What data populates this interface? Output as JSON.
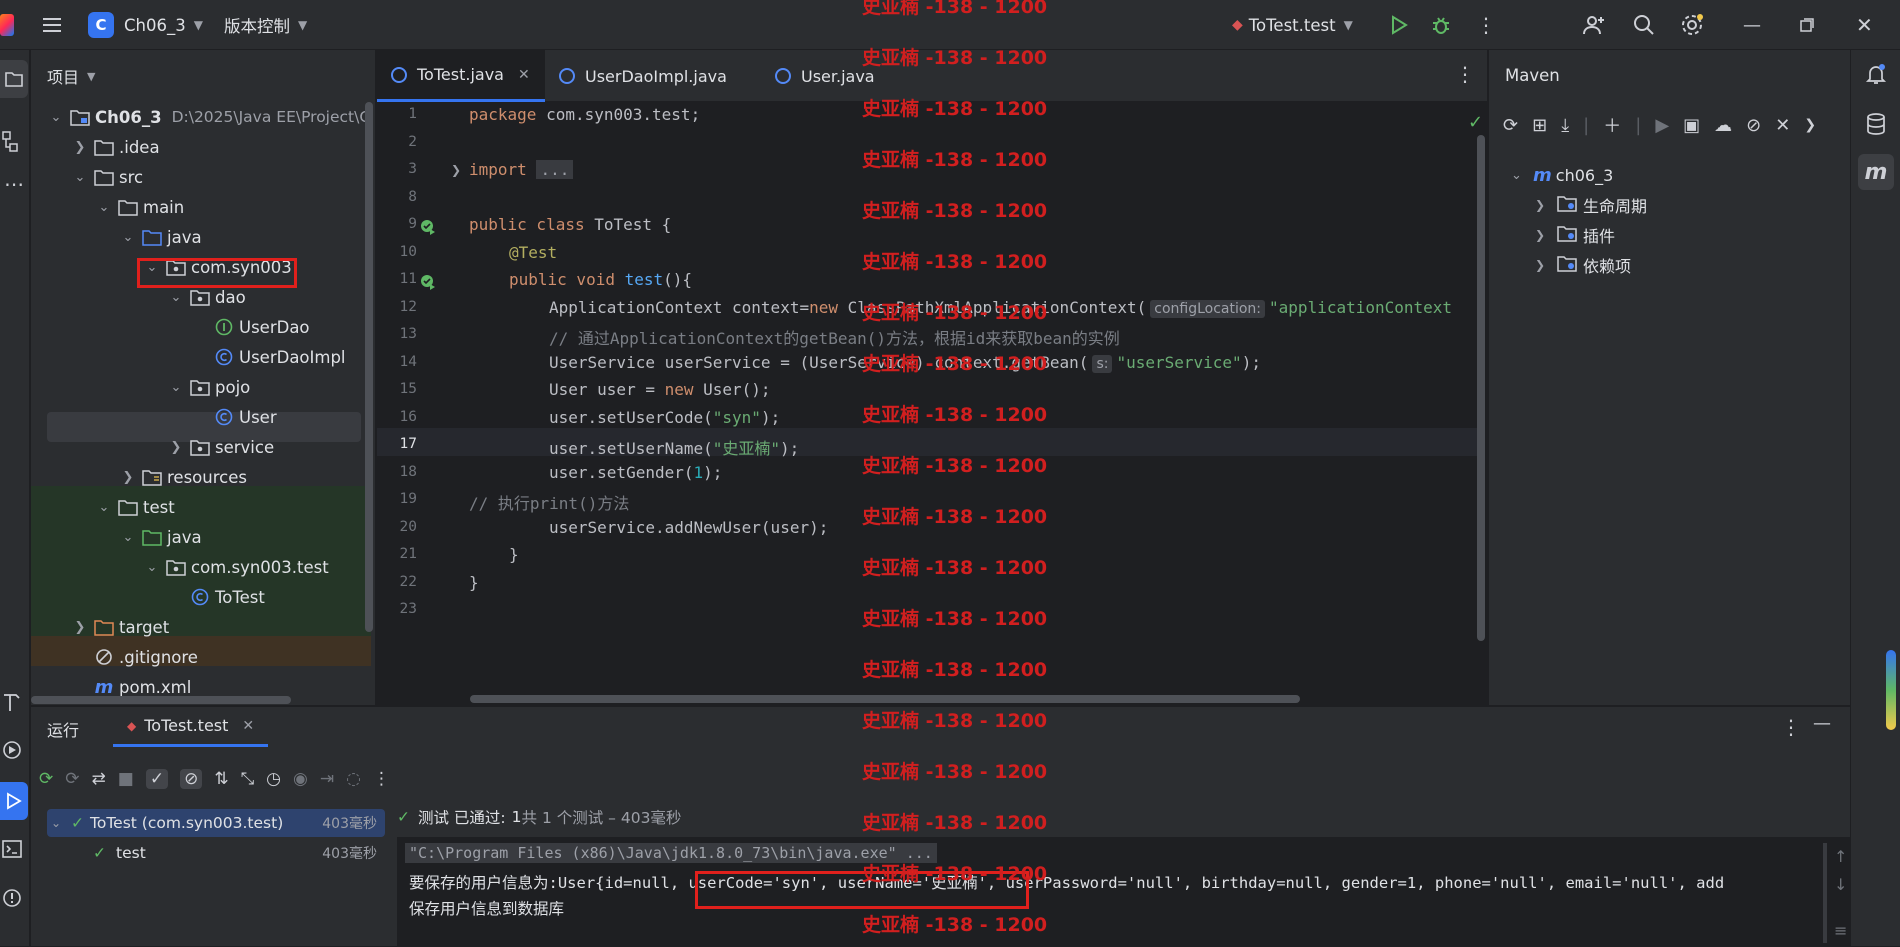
{
  "titlebar": {
    "project_letter": "C",
    "project_name": "Ch06_3",
    "vcs_label": "版本控制",
    "run_config": "ToTest.test"
  },
  "project_panel": {
    "title": "项目",
    "root_name": "Ch06_3",
    "root_path": "D:\\2025\\Java EE\\Project\\C",
    "items": [
      {
        "label": "Ch06_3"
      },
      {
        "label": ".idea"
      },
      {
        "label": "src"
      },
      {
        "label": "main"
      },
      {
        "label": "java"
      },
      {
        "label": "com.syn003"
      },
      {
        "label": "dao"
      },
      {
        "label": "UserDao"
      },
      {
        "label": "UserDaoImpl"
      },
      {
        "label": "pojo"
      },
      {
        "label": "User"
      },
      {
        "label": "service"
      },
      {
        "label": "resources"
      },
      {
        "label": "test"
      },
      {
        "label": "java"
      },
      {
        "label": "com.syn003.test"
      },
      {
        "label": "ToTest"
      },
      {
        "label": "target"
      },
      {
        "label": ".gitignore"
      },
      {
        "label": "pom.xml"
      }
    ]
  },
  "editor": {
    "tabs": [
      {
        "label": "ToTest.java"
      },
      {
        "label": "UserDaoImpl.java"
      },
      {
        "label": "User.java"
      }
    ],
    "line_numbers": [
      "1",
      "2",
      "3",
      "8",
      "9",
      "10",
      "11",
      "12",
      "13",
      "14",
      "15",
      "16",
      "17",
      "18",
      "19",
      "20",
      "21",
      "22",
      "23"
    ],
    "code": {
      "l1a": "package",
      "l1b": " com.syn003.test;",
      "l3a": "import",
      "l3b": "...",
      "l9a": "public class",
      "l9b": " ToTest {",
      "l10": "@Test",
      "l11a": "public void",
      "l11b": "test",
      "l11c": "(){",
      "l12a": "ApplicationContext context=",
      "l12b": "new",
      "l12c": " ClassPathXmlApplicationContext(",
      "l12hint": "configLocation:",
      "l12d": "\"applicationContext",
      "l13": "// 通过ApplicationContext的getBean()方法，根据id来获取bean的实例",
      "l14a": "UserService userService = (UserService) context.getBean(",
      "l14hint": "s:",
      "l14b": "\"userService\"",
      "l14c": ");",
      "l15a": "User user = ",
      "l15b": "new",
      "l15c": " User();",
      "l16a": "user.setUserCode(",
      "l16b": "\"syn\"",
      "l16c": ");",
      "l17a": "user.setUserName(",
      "l17b": "\"史亚楠\"",
      "l17c": ");",
      "l18a": "user.setGender(",
      "l18b": "1",
      "l18c": ");",
      "l19": "// 执行print()方法",
      "l20": "userService.addNewUser(user);",
      "l21": "}",
      "l22": "}"
    }
  },
  "maven": {
    "title": "Maven",
    "root": "ch06_3",
    "items": [
      {
        "label": "生命周期"
      },
      {
        "label": "插件"
      },
      {
        "label": "依赖项"
      }
    ]
  },
  "run_panel": {
    "title": "运行",
    "tab": "ToTest.test",
    "tree": [
      {
        "label": "ToTest (com.syn003.test)",
        "time": "403毫秒"
      },
      {
        "label": "test",
        "time": "403毫秒"
      }
    ],
    "status_a": "测试 已通过:",
    "status_b": "1",
    "status_c": "共 1 个测试 – 403毫秒",
    "console": {
      "line1": "\"C:\\Program Files (x86)\\Java\\jdk1.8.0_73\\bin\\java.exe\" ...",
      "line2": "要保存的用户信息为:User{id=null, userCode='syn', userName='史亚楠', userPassword='null', birthday=null, gender=1, phone='null', email='null', add",
      "line3": "保存用户信息到数据库"
    }
  },
  "watermark": {
    "text": "史亚楠 -138 - 1200"
  },
  "colors": {
    "accent": "#3574f0",
    "watermark": "#d11f1f",
    "highlight_box": "#e0201c",
    "pass_green": "#5fb865"
  }
}
